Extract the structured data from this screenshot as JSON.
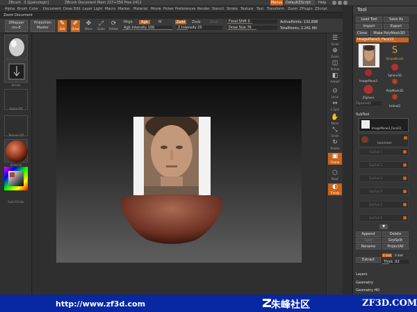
{
  "titlebar": {
    "app": "ZBrush",
    "version": "3.1[penologic]",
    "document": "ZBrush Document",
    "stats": "Mem 227+356  Free 2412",
    "menus_label": "Menus",
    "script_name": "DefaultZScript",
    "help_label": "Help"
  },
  "menubar": [
    "Alpha",
    "Brush",
    "Color",
    "Document",
    "Draw",
    "Edit",
    "Layer",
    "Light",
    "Macro",
    "Marker",
    "Material",
    "Movie",
    "Picker",
    "Preferences",
    "Render",
    "Stencil",
    "Stroke",
    "Texture",
    "Tool",
    "Transform",
    "Zoom",
    "ZPlugin",
    "ZScript"
  ],
  "doc_label": "Zoom Document",
  "shelf": {
    "zmapper": "ZMapper",
    "zmapper_sub": "rev-E",
    "projection_master": "Projection",
    "projection_master_sub": "Master",
    "tools": [
      "Edit",
      "Draw",
      "Move",
      "Scale",
      "Rotate"
    ],
    "mrgb": "Mrgb",
    "rgb": "Rgb",
    "m": "M",
    "rgb_intensity": "Rgb Intensity 100",
    "zadd": "Zadd",
    "zsub": "Zsub",
    "z_intensity": "Z Intensity 25",
    "zcut": "Zcut",
    "focal_shift": "Focal Shift 0",
    "draw_size": "Draw Size 76",
    "active_points": "ActivePoints: 132,898",
    "total_points": "TotalPoints: 2.241 Mil"
  },
  "left_shelf": {
    "labels": [
      "Brush",
      "Stroke",
      "Alpha Off",
      "Texture Off",
      "Material",
      "SwitchColor"
    ]
  },
  "right_dock": [
    "Scroll",
    "Zoom",
    "Actual",
    "AAHalf",
    "Local",
    "L.Sym",
    "Move",
    "Scale",
    "Rotate",
    "Frame",
    "PolyF",
    "Transp"
  ],
  "tool_panel": {
    "title": "Tool",
    "load_tool": "Load Tool",
    "save_as": "Save As",
    "import": "Import",
    "export": "Export",
    "clone": "Clone",
    "make_polymesh": "Make PolyMesh3D",
    "current_tool": "ImagePlane3_Face22_",
    "tools": [
      "ImagePlane3",
      "SimpleBrush",
      "Sphere3D",
      "PolyMesh3D",
      "ZSphere",
      "ZSphere01",
      "helmet2"
    ],
    "subtool_label": "SubTool",
    "subtool_1": "ImagePlane3_Face22_",
    "subtool_2": "face/mesh",
    "subtool_slots": [
      "SubTool 1",
      "SubTool 2",
      "SubTool 3",
      "SubTool 4",
      "SubTool 5",
      "SubTool 6",
      "SubTool 7",
      "SubTool 8"
    ],
    "append": "Append",
    "delete": "Delete",
    "split": "Split",
    "grp_split": "GrpSplit",
    "rename": "Rename",
    "project_all": "ProjectAll",
    "extract": "Extract",
    "e_smt": "E Smt",
    "s_smt": "S Smt",
    "thick": "Thick .02",
    "sections": [
      "Layers",
      "Geometry",
      "Geometry HD"
    ]
  },
  "footer": {
    "url": "http://www.zf3d.com",
    "brand": "朱峰社区",
    "site": "ZF3D.COM"
  },
  "colors": {
    "accent": "#c8641e",
    "footer_bg": "#0727a3",
    "panel_bg": "#363636"
  }
}
